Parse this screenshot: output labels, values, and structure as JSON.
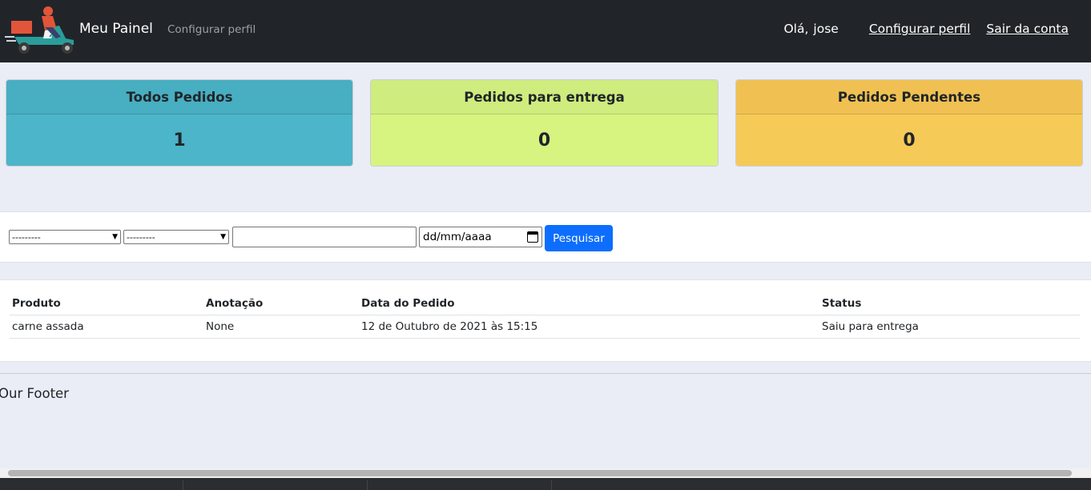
{
  "navbar": {
    "brand": "Meu Painel",
    "profile_link_muted": "Configurar perfil",
    "greeting": "Olá,",
    "username": "jose",
    "profile_link": "Configurar perfil",
    "logout_link": "Sair da conta"
  },
  "cards": [
    {
      "title": "Todos Pedidos",
      "value": "1"
    },
    {
      "title": "Pedidos para entrega",
      "value": "0"
    },
    {
      "title": "Pedidos Pendentes",
      "value": "0"
    }
  ],
  "filters": {
    "select1": "---------",
    "select2": "---------",
    "text_value": "",
    "date_placeholder": "dd/mm/aaaa",
    "search_button": "Pesquisar"
  },
  "table": {
    "headers": [
      "Produto",
      "Anotação",
      "Data do Pedido",
      "Status"
    ],
    "rows": [
      [
        "carne assada",
        "None",
        "12 de Outubro de 2021 às 15:15",
        "Saiu para entrega"
      ]
    ]
  },
  "footer": {
    "title": "Our Footer"
  },
  "colors": {
    "navbar": "#212529",
    "card_all": "#4cb5c9",
    "card_delivery": "#d7f480",
    "card_pending": "#f6ca56",
    "primary_button": "#0d6efd"
  }
}
